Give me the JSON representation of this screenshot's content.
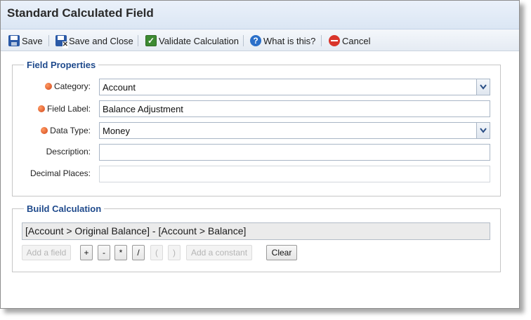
{
  "window": {
    "title": "Standard Calculated Field"
  },
  "toolbar": {
    "save": "Save",
    "save_close": "Save and Close",
    "validate": "Validate Calculation",
    "help": "What is this?",
    "cancel": "Cancel"
  },
  "field_properties": {
    "legend": "Field Properties",
    "category_label": "Category:",
    "category_value": "Account",
    "field_label_label": "Field Label:",
    "field_label_value": "Balance Adjustment",
    "data_type_label": "Data Type:",
    "data_type_value": "Money",
    "description_label": "Description:",
    "description_value": "",
    "decimal_label": "Decimal Places:",
    "decimal_value": ""
  },
  "build_calculation": {
    "legend": "Build Calculation",
    "expression": "[Account > Original Balance] - [Account > Balance]",
    "add_field": "Add a field",
    "plus": "+",
    "minus": "-",
    "multiply": "*",
    "divide": "/",
    "open_paren": "(",
    "close_paren": ")",
    "add_constant": "Add a constant",
    "clear": "Clear"
  }
}
